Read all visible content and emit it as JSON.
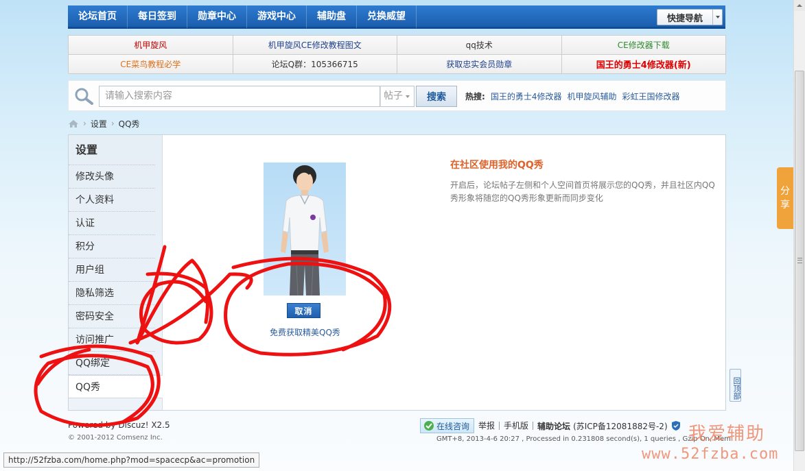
{
  "nav": {
    "items": [
      "论坛首页",
      "每日签到",
      "勋章中心",
      "游戏中心",
      "辅助盘",
      "兑换威望"
    ],
    "quicknav_label": "快捷导航"
  },
  "links": [
    {
      "text": "机甲旋风",
      "color": "#c00000"
    },
    {
      "text": "机甲旋风CE修改教程图文",
      "color": "#1d3f8c"
    },
    {
      "text": "qq技术",
      "color": "#333333"
    },
    {
      "text": "CE修改器下载",
      "color": "#2f8a2f"
    },
    {
      "text": "CE菜鸟教程必学",
      "color": "#e0701a"
    },
    {
      "text": "论坛Q群：105366715",
      "color": "#333333"
    },
    {
      "text": "获取忠实会员勋章",
      "color": "#1d3f8c"
    },
    {
      "text": "国王的勇士4修改器(新)",
      "color": "#e00000"
    }
  ],
  "search": {
    "placeholder": "请输入搜索内容",
    "type": "帖子",
    "button": "搜索",
    "hot_label": "热搜:",
    "hot_links": [
      "国王的勇士4修改器",
      "机甲旋风辅助",
      "彩虹王国修改器"
    ]
  },
  "breadcrumb": [
    "设置",
    "QQ秀"
  ],
  "sidebar": {
    "title": "设置",
    "items": [
      "修改头像",
      "个人资料",
      "认证",
      "积分",
      "用户组",
      "隐私筛选",
      "密码安全",
      "访问推广",
      "QQ绑定",
      "QQ秀"
    ]
  },
  "content": {
    "cancel_button": "取消",
    "free_link": "免费获取精美QQ秀",
    "info_title": "在社区使用我的QQ秀",
    "info_desc": "开启后，论坛帖子左侧和个人空间首页将展示您的QQ秀，并且社区内QQ秀形象将随您的QQ秀形象更新而同步变化"
  },
  "footer": {
    "powered": "Powered by Discuz! X2.5",
    "copyright": "© 2001-2012 Comsenz Inc.",
    "online": "在线咨询",
    "links": [
      "举报",
      "手机版"
    ],
    "site": "辅助论坛",
    "icp": "(苏ICP备12081882号-2)",
    "gmt": "GMT+8, 2013-4-6 20:27 , Processed in 0.231808 second(s), 1 queries , Gzip On, Mem"
  },
  "share": [
    "分",
    "享"
  ],
  "backtop": "回顶部",
  "status_url": "http://52fzba.com/home.php?mod=spacecp&ac=promotion",
  "watermark": {
    "line1": "我爱辅助",
    "line2": "www.52fzba.com"
  }
}
